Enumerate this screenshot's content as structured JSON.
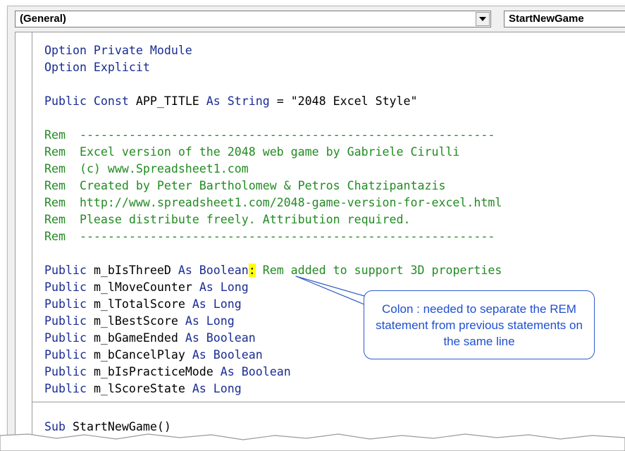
{
  "toolbar": {
    "object_combo": "(General)",
    "procedure_combo": "StartNewGame"
  },
  "code": {
    "line1": "Option Private Module",
    "line2": "Option Explicit",
    "const_kw1": "Public Const",
    "const_name": " APP_TITLE ",
    "const_kw2": "As String",
    "const_rest": " = \"2048 Excel Style\"",
    "rem": [
      "Rem  -----------------------------------------------------------",
      "Rem  Excel version of the 2048 web game by Gabriele Cirulli",
      "Rem  (c) www.Spreadsheet1.com",
      "Rem  Created by Peter Bartholomew & Petros Chatzipantazis",
      "Rem  http://www.spreadsheet1.com/2048-game-version-for-excel.html",
      "Rem  Please distribute freely. Attribution required.",
      "Rem  -----------------------------------------------------------"
    ],
    "decl_first": {
      "kw": "Public",
      "name": " m_bIsThreeD ",
      "type": "As Boolean",
      "colon": ":",
      "comment": " Rem added to support 3D properties"
    },
    "decls": [
      {
        "name": " m_lMoveCounter ",
        "type": "As Long"
      },
      {
        "name": " m_lTotalScore ",
        "type": "As Long"
      },
      {
        "name": " m_lBestScore ",
        "type": "As Long"
      },
      {
        "name": " m_bGameEnded ",
        "type": "As Boolean"
      },
      {
        "name": " m_bCancelPlay ",
        "type": "As Boolean"
      },
      {
        "name": " m_bIsPracticeMode ",
        "type": "As Boolean"
      },
      {
        "name": " m_lScoreState ",
        "type": "As Long"
      }
    ],
    "decl_kw": "Public",
    "sub_kw": "Sub",
    "sub_rest": " StartNewGame()"
  },
  "callout": {
    "text": "Colon : needed to separate the REM statement from previous statements on the same line"
  },
  "colors": {
    "keyword": "#1a2c93",
    "comment": "#228b22",
    "highlight": "#ffff00",
    "callout": "#1f4fd0"
  }
}
